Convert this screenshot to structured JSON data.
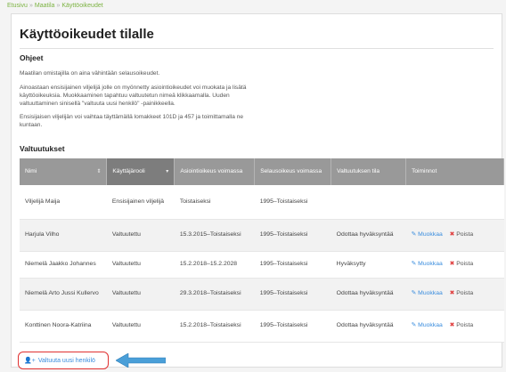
{
  "breadcrumb": {
    "items": [
      "Etusivu",
      "Maatila",
      "Käyttöoikeudet"
    ],
    "separator": "»"
  },
  "page": {
    "title": "Käyttöoikeudet tilalle"
  },
  "instructions": {
    "title": "Ohjeet",
    "p1": "Maatilan omistajilla on aina vähintään selausoikeudet.",
    "p2": "Ainoastaan ensisijainen viljelijä jolle on myönnetty asiointioikeudet voi muokata ja lisätä käyttöoikeuksia. Muokkaaminen tapahtuu valtuutetun nimeä klikkaamalla. Uuden valtuuttaminen sinisellä \"valtuuta uusi henkilö\" -painikkeella.",
    "p3": "Ensisijaisen viljelijän voi vaihtaa täyttämällä lomakkeet 101D ja 457 ja toimittamalla ne kuntaan."
  },
  "rights": {
    "title": "Valtuutukset",
    "columns": {
      "name": "Nimi",
      "role": "Käyttäjärooli",
      "asiointi": "Asiointioikeus voimassa",
      "selaus": "Selausoikeus voimassa",
      "status": "Valtuutuksen tila",
      "actions": "Toiminnot"
    },
    "rows": [
      {
        "name": "Viljelijä Maija",
        "role": "Ensisijainen viljelijä",
        "asiointi": "Toistaiseksi",
        "selaus": "1995–Toistaiseksi",
        "status": "",
        "edit": "",
        "remove": ""
      },
      {
        "name": "Harjula Vilho",
        "role": "Valtuutettu",
        "asiointi": "15.3.2015–Toistaiseksi",
        "selaus": "1995–Toistaiseksi",
        "status": "Odottaa hyväksyntää",
        "edit": "Muokkaa",
        "remove": "Poista"
      },
      {
        "name": "Niemelä Jaakko Johannes",
        "role": "Valtuutettu",
        "asiointi": "15.2.2018–15.2.2028",
        "selaus": "1995–Toistaiseksi",
        "status": "Hyväksytty",
        "edit": "Muokkaa",
        "remove": "Poista"
      },
      {
        "name": "Niemelä Arto Jussi Kullervo",
        "role": "Valtuutettu",
        "asiointi": "29.3.2018–Toistaiseksi",
        "selaus": "1995–Toistaiseksi",
        "status": "Odottaa hyväksyntää",
        "edit": "Muokkaa",
        "remove": "Poista"
      },
      {
        "name": "Konttinen Noora-Katriina",
        "role": "Valtuutettu",
        "asiointi": "15.2.2018–Toistaiseksi",
        "selaus": "1995–Toistaiseksi",
        "status": "Odottaa hyväksyntää",
        "edit": "Muokkaa",
        "remove": "Poista"
      }
    ]
  },
  "add_button": {
    "label": "Valtuuta uusi henkilö"
  },
  "colors": {
    "breadcrumb": "#7cb342",
    "link": "#3a8dde",
    "delete": "#e04040",
    "header": "#999999",
    "highlight": "#e03030",
    "arrow": "#4a9fd8"
  },
  "icons": {
    "edit": "pencil-square-icon",
    "remove": "cross-icon",
    "add": "user-plus-icon",
    "arrow": "left-arrow-icon"
  }
}
